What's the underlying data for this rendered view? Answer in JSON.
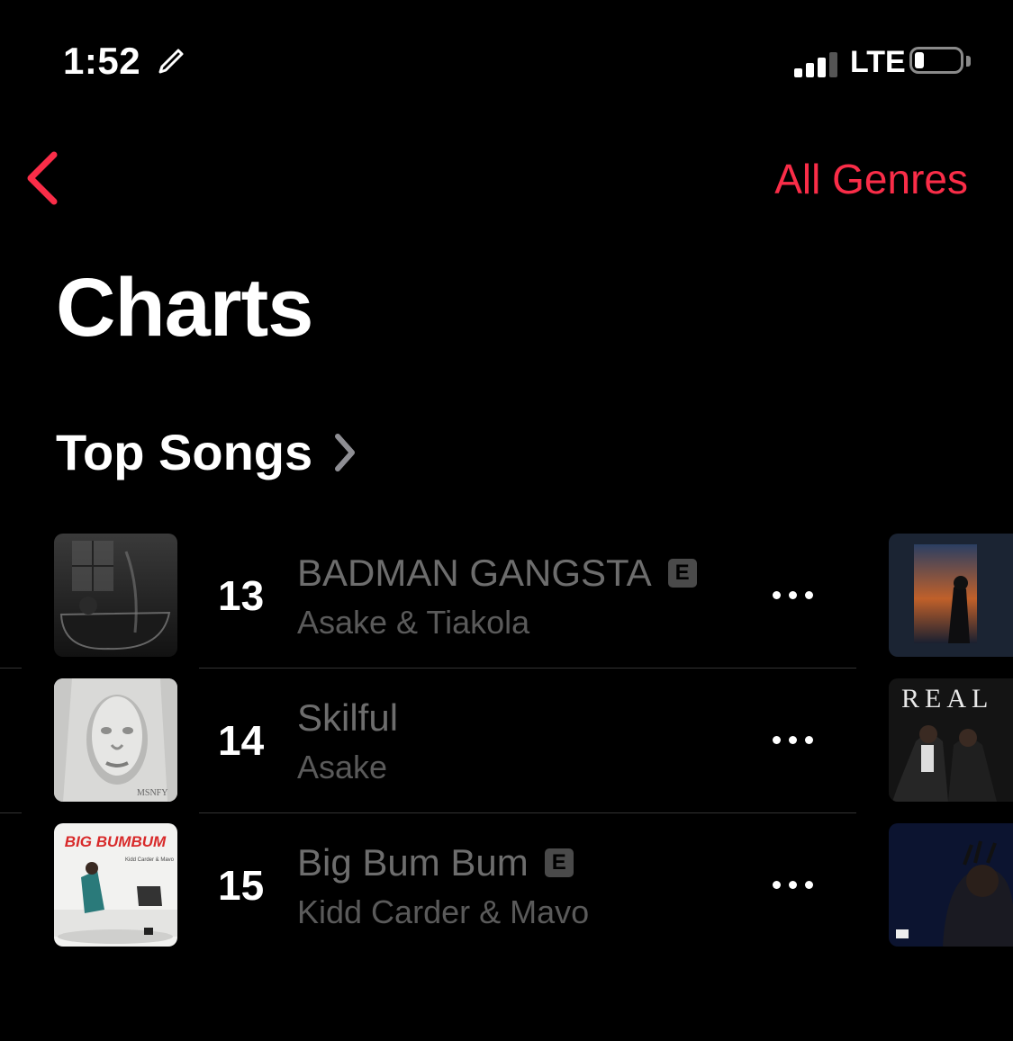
{
  "status_bar": {
    "time": "1:52",
    "network": "LTE"
  },
  "nav": {
    "genre_button": "All Genres"
  },
  "page": {
    "title": "Charts",
    "section_title": "Top Songs"
  },
  "songs": [
    {
      "rank": "13",
      "title": "BADMAN GANGSTA",
      "artist": "Asake & Tiakola",
      "explicit": true
    },
    {
      "rank": "14",
      "title": "Skilful",
      "artist": "Asake",
      "explicit": false
    },
    {
      "rank": "15",
      "title": "Big Bum Bum",
      "artist": "Kidd Carder & Mavo",
      "explicit": true
    }
  ],
  "explicit_badge": "E",
  "artwork_text": {
    "song_14_signature": "MSNFY",
    "song_15_title": "BIG BUMBUM",
    "song_15_credit": "Kidd Carder & Mavo",
    "peek_2_title": "REAL"
  },
  "icons": {
    "pencil": "pencil-icon",
    "signal": "cellular-signal-icon",
    "battery": "battery-icon",
    "back": "chevron-left-icon",
    "section": "chevron-right-icon",
    "more": "ellipsis-icon"
  },
  "colors": {
    "accent": "#fa2d48",
    "background": "#000000",
    "dimmed_text": "#6d6d6d"
  },
  "battery_level": 0.15,
  "signal_bars": 3
}
